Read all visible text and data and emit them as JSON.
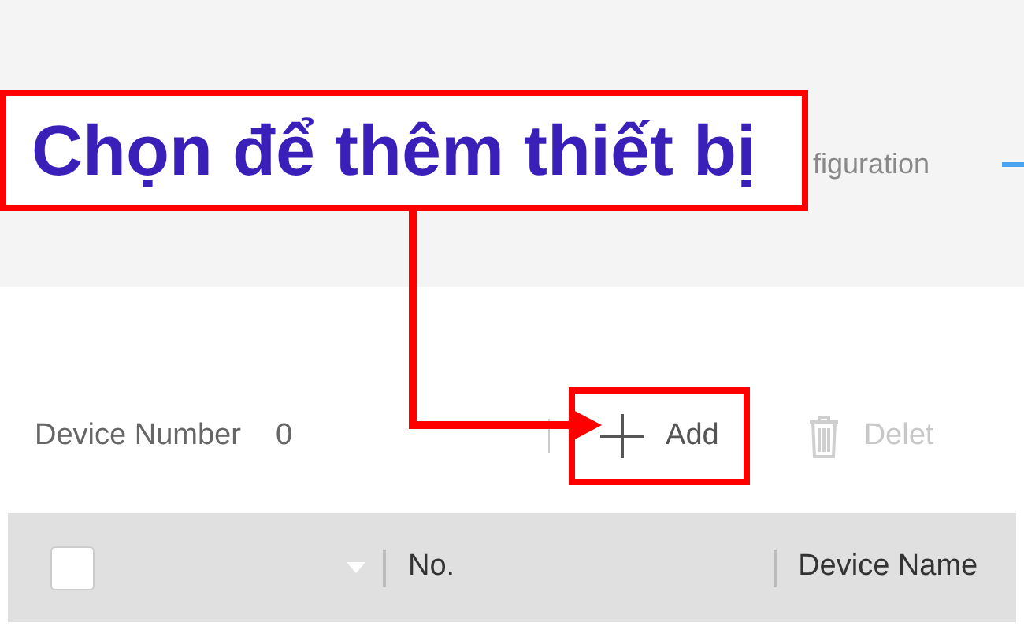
{
  "callout": {
    "text": "Chọn để thêm thiết bị"
  },
  "steps": {
    "label": "figuration"
  },
  "toolbar": {
    "device_number_label": "Device Number",
    "device_number_value": "0",
    "buttons": [
      {
        "kind": "add",
        "label": "Add",
        "disabled": false,
        "highlighted": true
      },
      {
        "kind": "delete",
        "label": "Delet",
        "disabled": true,
        "highlighted": false
      }
    ]
  },
  "table": {
    "select_all": {
      "checked": false
    },
    "columns": [
      "No.",
      "Device Name"
    ]
  }
}
